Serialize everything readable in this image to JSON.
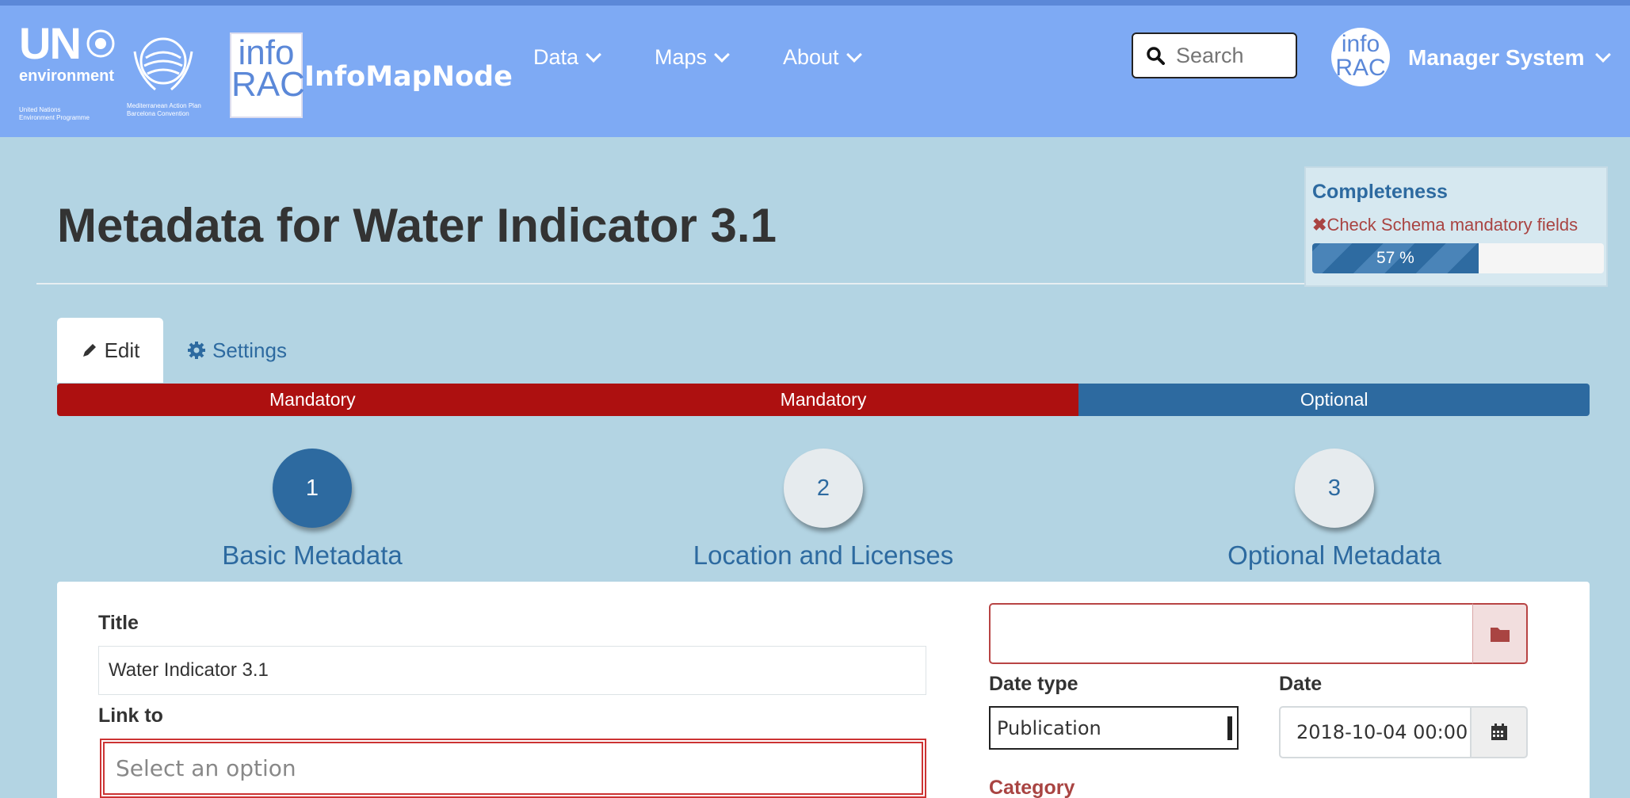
{
  "header": {
    "un_logo": {
      "mark": "UN",
      "line1": "environment",
      "line2": "United Nations",
      "line3": "Environment Programme"
    },
    "map_logo": {
      "line1": "Mediterranean Action Plan",
      "line2": "Barcelona Convention"
    },
    "inforac_logo": {
      "line1": "info",
      "line2": "RAC"
    },
    "brand": "InfoMapNode",
    "nav": [
      {
        "label": "Data"
      },
      {
        "label": "Maps"
      },
      {
        "label": "About"
      }
    ],
    "search": {
      "placeholder": "Search",
      "value": ""
    },
    "avatar_text": {
      "line1": "info",
      "line2": "RAC"
    },
    "user_name": "Manager System",
    "colors": {
      "bar": "#7eaaf4"
    }
  },
  "page": {
    "title": "Metadata for Water Indicator 3.1"
  },
  "completeness": {
    "title": "Completeness",
    "check_text": "Check Schema mandatory fields",
    "percent": 57,
    "percent_label": "57 %"
  },
  "tabs": [
    {
      "label": "Edit",
      "icon": "pencil-icon",
      "active": true
    },
    {
      "label": "Settings",
      "icon": "gear-icon",
      "active": false
    }
  ],
  "stepbar": [
    {
      "label": "Mandatory",
      "status": "mandatory",
      "color": "#ad1010"
    },
    {
      "label": "Mandatory",
      "status": "mandatory",
      "color": "#ad1010"
    },
    {
      "label": "Optional",
      "status": "optional",
      "color": "#2d6aa0"
    }
  ],
  "steps": [
    {
      "number": "1",
      "label": "Basic Metadata",
      "active": true
    },
    {
      "number": "2",
      "label": "Location and Licenses",
      "active": false
    },
    {
      "number": "3",
      "label": "Optional Metadata",
      "active": false
    }
  ],
  "form": {
    "title_label": "Title",
    "title_value": "Water Indicator 3.1",
    "link_label": "Link to",
    "link_placeholder": "Select an option",
    "date_type_label": "Date type",
    "date_type_value": "Publication",
    "date_label": "Date",
    "date_value": "2018-10-04 00:00",
    "category_label": "Category"
  }
}
